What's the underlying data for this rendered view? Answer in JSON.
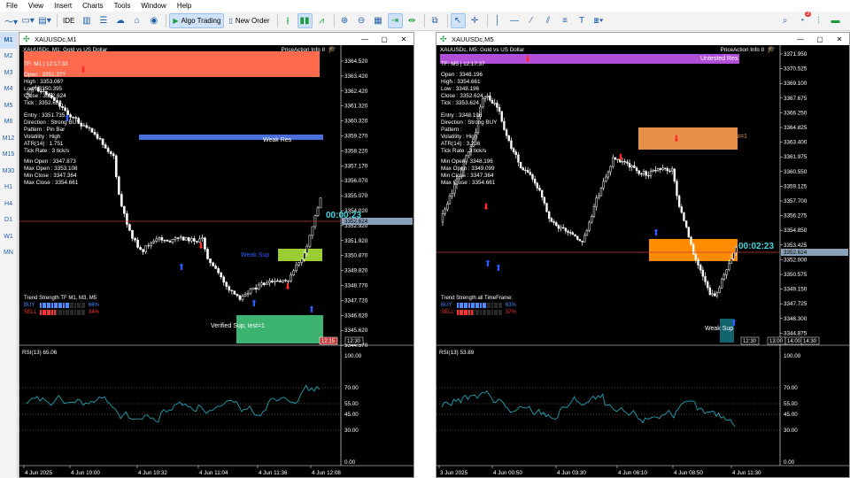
{
  "menu": [
    "File",
    "View",
    "Insert",
    "Charts",
    "Tools",
    "Window",
    "Help"
  ],
  "toolbar": {
    "algo_trading": "Algo Trading",
    "new_order": "New Order",
    "ide": "IDE",
    "notification_count": "3"
  },
  "timeframes": [
    "M1",
    "M2",
    "M3",
    "M4",
    "M5",
    "M6",
    "M12",
    "M15",
    "M30",
    "H1",
    "H4",
    "D1",
    "W1",
    "MN"
  ],
  "charts": [
    {
      "title": "XAUUSDc,M1",
      "header": "XAUUSDc, M1:  Gold vs US Dollar",
      "indicator_name": "PriceAction Info II",
      "tf_line": "TF: M1 | 12:17:33",
      "ohlc": [
        "Open  : 3351.3??",
        "High  : 3353.06?",
        "Low   : 3350.395",
        "Close : 3352.624",
        "Tick  : 3352.624"
      ],
      "signal": [
        "Entry    : 3351.735",
        "Direction : Strong BUY",
        "Pattern   : Pin Bar",
        "Volatility : High",
        "ATR(14)   : 1.751",
        "Tick Rate : 3 tick/s"
      ],
      "minmax": [
        "Min Open  : 3347.873",
        "Max Open  : 3353.108",
        "Min Close : 3347.364",
        "Max Close : 3354.661"
      ],
      "trend_title": "Trend Strength TF M1, M3, M5",
      "buy_label": "BUY",
      "buy_pct": "66%",
      "buy_fraction": 0.66,
      "sell_label": "SELL",
      "sell_pct": "34%",
      "sell_fraction": 0.34,
      "zone_top_label": "",
      "zone_weak_res": "Weak Res",
      "zone_sup_label": "Weak Sup",
      "zone_verified_sup": "Verified Sup, test=1",
      "timer": "00:00:23",
      "price_labels": [
        "3364.520",
        "3363.420",
        "3362.420",
        "3361.320",
        "3360.320",
        "3359.270",
        "3358.220",
        "3357.170",
        "3356.070",
        "3355.070",
        "3354.020",
        "3352.920",
        "3351.920",
        "3350.870",
        "3349.820",
        "3348.770",
        "3347.720",
        "3346.620",
        "3345.620",
        "3344.570"
      ],
      "current_price": "3352.624",
      "time_marks": [
        "12:15",
        "12:30"
      ],
      "rsi_title": "RSI(13) 65.06",
      "rsi_levels": [
        "100.00",
        "70.00",
        "55.00",
        "45.00",
        "30.00",
        "0.00"
      ],
      "time_axis": [
        "4 Jun 2025",
        "4 Jun 10:00",
        "4 Jun 10:32",
        "4 Jun 11:04",
        "4 Jun 11:36",
        "4 Jun 12:08"
      ]
    },
    {
      "title": "XAUUSDc,M5",
      "header": "XAUUSDc, M5:  Gold vs US Dollar",
      "indicator_name": "PriceAction Info II",
      "tf_line": "TF: M5 | 12:17:37",
      "ohlc": [
        "Open  : 3348.196",
        "High  : 3354.661",
        "Low   : 3348.196",
        "Close : 3352.624",
        "Tick  : 3353.624"
      ],
      "signal": [
        "Entry    : 3348.196",
        "Direction : Strong BUY",
        "Pattern   :",
        "Volatility : High",
        "ATR(14)   : 3.236",
        "Tick Rate : 3 tick/s"
      ],
      "minmax": [
        "Min Open  : 3348.196",
        "Max Open  : 3349.099",
        "Min Close : 3347.364",
        "Max Close : 3354.661"
      ],
      "trend_title": "Trend Strength all TimeFrame:",
      "buy_label": "BUY",
      "buy_pct": "63%",
      "buy_fraction": 0.63,
      "sell_label": "SELL",
      "sell_pct": "37%",
      "sell_fraction": 0.37,
      "zone_top_label": "Untested Res",
      "zone_weak_res": "Verified Res, test=1",
      "zone_sup_label": "Weak Sup",
      "zone_verified_sup": "",
      "timer": "00:02:23",
      "price_labels": [
        "3371.950",
        "3370.525",
        "3369.100",
        "3367.675",
        "3366.250",
        "3364.825",
        "3363.400",
        "3361.975",
        "3360.550",
        "3359.125",
        "3357.700",
        "3356.275",
        "3354.850",
        "3353.425",
        "3352.000",
        "3350.575",
        "3349.150",
        "3347.725",
        "3346.300",
        "3344.875"
      ],
      "current_price": "3352.624",
      "time_marks": [
        "12:30",
        "13:00",
        "14:00",
        "14:30"
      ],
      "rsi_title": "RSI(13) 53.89",
      "rsi_levels": [
        "100.00",
        "70.00",
        "55.00",
        "45.00",
        "30.00",
        "0.00"
      ],
      "time_axis": [
        "3 Jun 2025",
        "4 Jun 00:50",
        "4 Jun 03:30",
        "4 Jun 06:10",
        "4 Jun 08:50",
        "4 Jun 11:30"
      ]
    }
  ],
  "colors": {
    "res_red": "#ff6a4d",
    "weak_res_blue": "#4a6fdc",
    "sup_lime": "#9acd32",
    "sup_green": "#3cb371",
    "untested_purple": "#b24fd9",
    "verified_orange": "#e8904a",
    "sup_orange": "#ff8c00",
    "rsi_line": "#1fb5c8",
    "timer_cyan": "#42d7e0"
  }
}
